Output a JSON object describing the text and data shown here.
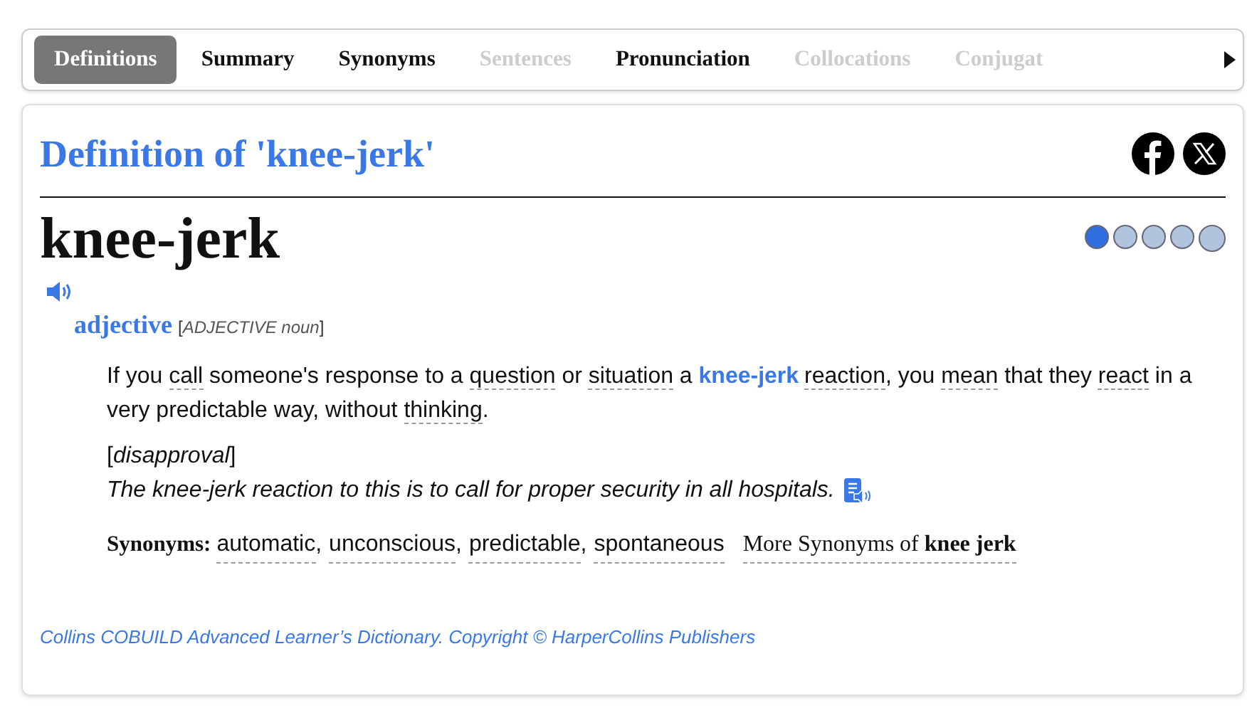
{
  "tabs": [
    {
      "label": "Definitions",
      "selected": true,
      "disabled": false
    },
    {
      "label": "Summary",
      "selected": false,
      "disabled": false
    },
    {
      "label": "Synonyms",
      "selected": false,
      "disabled": false
    },
    {
      "label": "Sentences",
      "selected": false,
      "disabled": true
    },
    {
      "label": "Pronunciation",
      "selected": false,
      "disabled": false
    },
    {
      "label": "Collocations",
      "selected": false,
      "disabled": true
    },
    {
      "label": "Conjugat",
      "selected": false,
      "disabled": true
    }
  ],
  "entry": {
    "title": "Definition of 'knee-jerk'",
    "headword": "knee-jerk",
    "frequency": {
      "stars": 1
    },
    "pos": "adjective",
    "grammar": "[*ADJECTIVE noun*]",
    "definition": [
      {
        "kind": "plain",
        "text": "If you "
      },
      {
        "kind": "link",
        "text": "call"
      },
      {
        "kind": "plain",
        "text": " someone's response to a "
      },
      {
        "kind": "link",
        "text": "question"
      },
      {
        "kind": "plain",
        "text": " or "
      },
      {
        "kind": "link",
        "text": "situation"
      },
      {
        "kind": "plain",
        "text": " a "
      },
      {
        "kind": "headword",
        "text": "knee-jerk"
      },
      {
        "kind": "link",
        "text": "reaction"
      },
      {
        "kind": "plain",
        "text": ", you "
      },
      {
        "kind": "link",
        "text": "mean"
      },
      {
        "kind": "plain",
        "text": " that they "
      },
      {
        "kind": "link",
        "text": "react"
      },
      {
        "kind": "plain",
        "text": " in a very predictable way, without "
      },
      {
        "kind": "link",
        "text": "thinking"
      },
      {
        "kind": "plain",
        "text": "."
      }
    ],
    "usage": "[*disapproval*]",
    "example": "The knee-jerk reaction to this is to call for proper security in all hospitals.",
    "synonyms_label": "Synonyms:",
    "synonyms": [
      {
        "text": "automatic",
        "separator": ","
      },
      {
        "text": "unconscious",
        "separator": ","
      },
      {
        "text": "predictable",
        "separator": ","
      },
      {
        "text": "spontaneous"
      }
    ],
    "more_synonyms": "More Synonyms of **knee jerk**",
    "source": "Collins COBUILD Advanced Learner’s Dictionary. Copyright © HarperCollins Publishers"
  }
}
